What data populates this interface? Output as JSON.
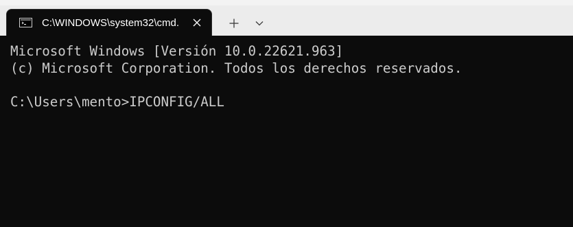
{
  "window": {
    "tab": {
      "icon": "command-prompt-icon",
      "title": "C:\\WINDOWS\\system32\\cmd.",
      "close_icon": "close-icon"
    },
    "new_tab_icon": "plus-icon",
    "dropdown_icon": "chevron-down-icon"
  },
  "terminal": {
    "lines": [
      "Microsoft Windows [Versión 10.0.22621.963]",
      "(c) Microsoft Corporation. Todos los derechos reservados.",
      "",
      "C:\\Users\\mento>IPCONFIG/ALL"
    ]
  },
  "colors": {
    "terminal_background": "#0c0c0c",
    "terminal_text": "#cccccc",
    "titlebar_background": "#ececec",
    "tab_text": "#ffffff"
  }
}
